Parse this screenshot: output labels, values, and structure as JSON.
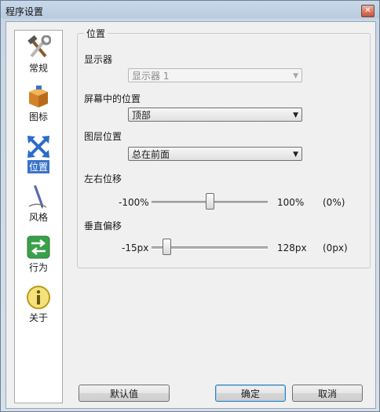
{
  "window": {
    "title": "程序设置",
    "close_glyph": "✕"
  },
  "sidebar": {
    "items": [
      {
        "label": "常规",
        "icon": "tools-icon"
      },
      {
        "label": "图标",
        "icon": "box-icon"
      },
      {
        "label": "位置",
        "icon": "move-arrows-icon",
        "active": true
      },
      {
        "label": "风格",
        "icon": "pen-icon"
      },
      {
        "label": "行为",
        "icon": "swap-arrows-icon"
      },
      {
        "label": "关于",
        "icon": "info-icon"
      }
    ]
  },
  "position_group": {
    "title": "位置",
    "monitor": {
      "label": "显示器",
      "value": "显示器 1",
      "disabled": true
    },
    "screen_position": {
      "label": "屏幕中的位置",
      "value": "顶部"
    },
    "layer": {
      "label": "图层位置",
      "value": "总在前面"
    },
    "horizontal_offset": {
      "label": "左右位移",
      "min_label": "-100%",
      "max_label": "100%",
      "current_label": "(0%)",
      "min": -100,
      "max": 100,
      "value": 0
    },
    "vertical_offset": {
      "label": "垂直偏移",
      "min_label": "-15px",
      "max_label": "128px",
      "current_label": "(0px)",
      "min": -15,
      "max": 128,
      "value": 0
    }
  },
  "footer": {
    "defaults_label": "默认值",
    "ok_label": "确定",
    "cancel_label": "取消"
  },
  "colors": {
    "accent": "#3a73c9",
    "title_bar": "#c9d9ea"
  }
}
